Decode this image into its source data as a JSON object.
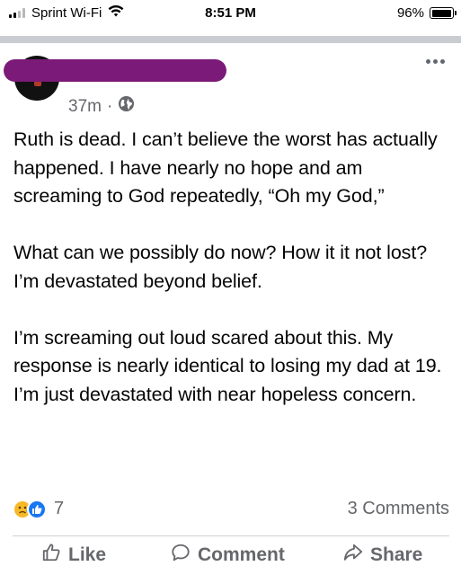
{
  "status_bar": {
    "carrier": "Sprint Wi-Fi",
    "time": "8:51 PM",
    "battery": "96%",
    "battery_level": 0.96
  },
  "post": {
    "timestamp": "37m",
    "separator": "·",
    "audience_icon": "globe-icon",
    "paragraphs": [
      "Ruth is dead. I can’t believe the worst has actually happened. I have nearly no hope and am screaming to God repeatedly, “Oh my God,”",
      "What can we possibly do now? How it it not lost? I’m devastated beyond belief.",
      "I’m screaming out loud scared about this. My response is nearly identical to losing my dad at 19. I’m just devastated with near hopeless concern."
    ],
    "reaction_icons": [
      "sad-reaction-icon",
      "like-reaction-icon"
    ],
    "reaction_count": "7",
    "comments_count": "3 Comments"
  },
  "actions": {
    "like_label": "Like",
    "comment_label": "Comment",
    "share_label": "Share"
  },
  "colors": {
    "redaction": "#7b1a78",
    "meta_text": "#65676b",
    "like_blue": "#1877f2",
    "sad_yellow": "#f7b928"
  }
}
